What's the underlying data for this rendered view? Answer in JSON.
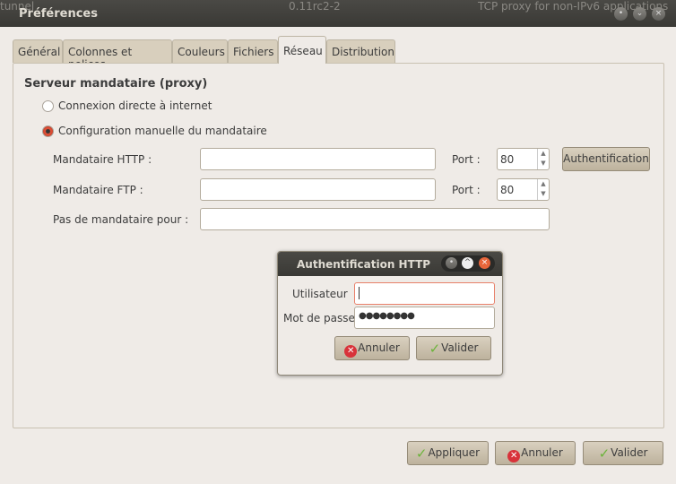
{
  "background_window": {
    "cells": [
      "tunnel",
      "0.11rc2-2",
      "TCP proxy for non-IPv6 applications"
    ]
  },
  "window": {
    "title": "Préférences",
    "controls": [
      "minimize",
      "maximize",
      "close"
    ]
  },
  "tabs": [
    {
      "label": "Général"
    },
    {
      "label": "Colonnes et polices"
    },
    {
      "label": "Couleurs"
    },
    {
      "label": "Fichiers"
    },
    {
      "label": "Réseau",
      "active": true
    },
    {
      "label": "Distribution"
    }
  ],
  "proxy": {
    "section_title": "Serveur mandataire (proxy)",
    "option_direct": "Connexion directe à internet",
    "option_manual": "Configuration manuelle du mandataire",
    "selected": "manual",
    "http_label": "Mandataire HTTP :",
    "http_value": "",
    "ftp_label": "Mandataire FTP :",
    "ftp_value": "",
    "port_label": "Port :",
    "http_port": "80",
    "ftp_port": "80",
    "auth_button": "Authentification",
    "noproxy_label": "Pas de mandataire pour :",
    "noproxy_value": ""
  },
  "dialog": {
    "title": "Authentification HTTP",
    "user_label": "Utilisateur",
    "user_value": "",
    "password_label": "Mot de passe",
    "password_value": "●●●●●●●●",
    "cancel": "Annuler",
    "ok": "Valider"
  },
  "footer": {
    "apply": "Appliquer",
    "cancel": "Annuler",
    "ok": "Valider"
  },
  "colors": {
    "accent": "#e8553b",
    "titlebar": "#3c3b37",
    "button": "#cdc3b0"
  }
}
